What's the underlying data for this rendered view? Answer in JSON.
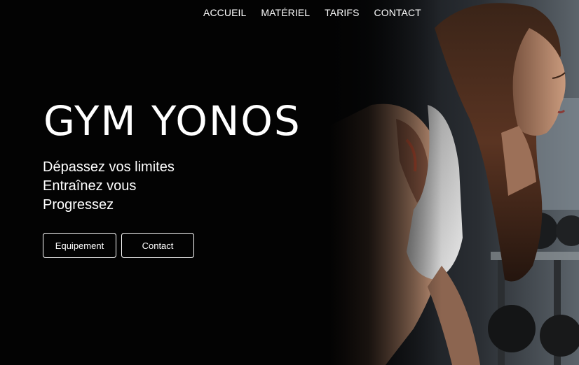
{
  "nav": {
    "items": [
      {
        "label": "ACCUEIL"
      },
      {
        "label": "MATÉRIEL"
      },
      {
        "label": "TARIFS"
      },
      {
        "label": "CONTACT"
      }
    ]
  },
  "hero": {
    "title": "GYM YONOS",
    "taglines": [
      "Dépassez vos limites",
      "Entraînez vous",
      "Progressez"
    ],
    "buttons": {
      "equipment_label": "Equipement",
      "contact_label": "Contact"
    },
    "background_color": "#030303",
    "image_alt": "woman-lifting-dumbbells-photo"
  }
}
